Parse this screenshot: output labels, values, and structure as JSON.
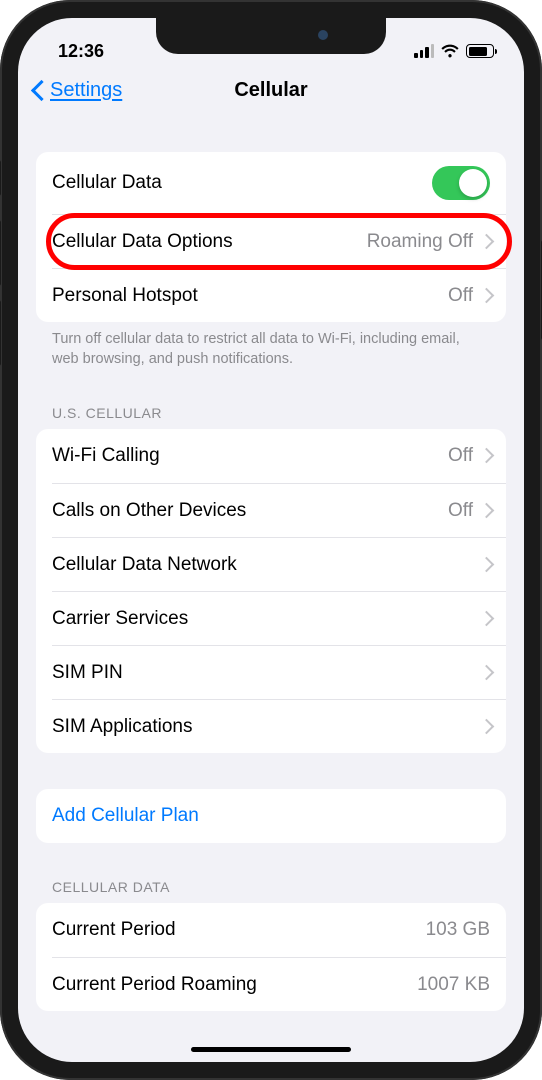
{
  "statusBar": {
    "time": "12:36"
  },
  "header": {
    "back": "Settings",
    "title": "Cellular"
  },
  "group1": {
    "rows": [
      {
        "label": "Cellular Data",
        "toggle": true
      },
      {
        "label": "Cellular Data Options",
        "detail": "Roaming Off",
        "highlighted": true
      },
      {
        "label": "Personal Hotspot",
        "detail": "Off"
      }
    ],
    "footer": "Turn off cellular data to restrict all data to Wi-Fi, including email, web browsing, and push notifications."
  },
  "group2": {
    "header": "U.S. CELLULAR",
    "rows": [
      {
        "label": "Wi-Fi Calling",
        "detail": "Off"
      },
      {
        "label": "Calls on Other Devices",
        "detail": "Off"
      },
      {
        "label": "Cellular Data Network",
        "detail": ""
      },
      {
        "label": "Carrier Services",
        "detail": ""
      },
      {
        "label": "SIM PIN",
        "detail": ""
      },
      {
        "label": "SIM Applications",
        "detail": ""
      }
    ]
  },
  "group3": {
    "rows": [
      {
        "label": "Add Cellular Plan"
      }
    ]
  },
  "group4": {
    "header": "CELLULAR DATA",
    "rows": [
      {
        "label": "Current Period",
        "detail": "103 GB"
      },
      {
        "label": "Current Period Roaming",
        "detail": "1007 KB"
      }
    ]
  }
}
